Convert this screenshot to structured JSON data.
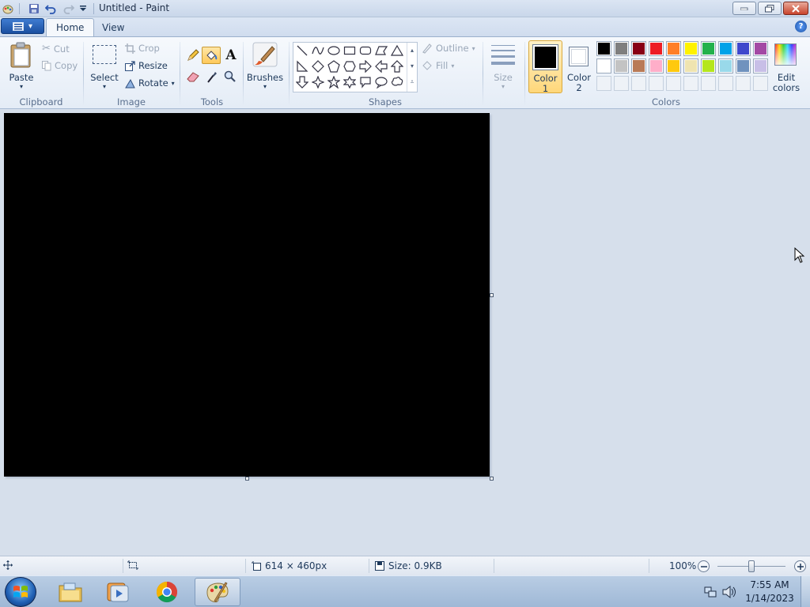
{
  "window": {
    "title": "Untitled - Paint"
  },
  "tabs": [
    {
      "label": "Home",
      "active": true
    },
    {
      "label": "View",
      "active": false
    }
  ],
  "clipboard": {
    "paste": "Paste",
    "cut": "Cut",
    "copy": "Copy",
    "group": "Clipboard"
  },
  "image": {
    "select": "Select",
    "crop": "Crop",
    "resize": "Resize",
    "rotate": "Rotate",
    "group": "Image"
  },
  "tools": {
    "group": "Tools",
    "selected": "fill-bucket"
  },
  "brushes": {
    "label": "Brushes"
  },
  "shapes": {
    "group": "Shapes",
    "outline": "Outline",
    "fill": "Fill"
  },
  "size": {
    "label": "Size"
  },
  "colors": {
    "color1_label_a": "Color",
    "color1_label_b": "1",
    "color2_label_a": "Color",
    "color2_label_b": "2",
    "color1": "#000000",
    "color2": "#ffffff",
    "edit_a": "Edit",
    "edit_b": "colors",
    "group": "Colors",
    "palette_row1": [
      "#000000",
      "#7f7f7f",
      "#880015",
      "#ed1c24",
      "#ff7f27",
      "#fff200",
      "#22b14c",
      "#00a2e8",
      "#3f48cc",
      "#a349a4"
    ],
    "palette_row2": [
      "#ffffff",
      "#c3c3c3",
      "#b97a57",
      "#ffaec9",
      "#ffc90e",
      "#efe4b0",
      "#b5e61d",
      "#99d9ea",
      "#7092be",
      "#c8bfe7"
    ]
  },
  "canvas": {
    "fill": "#000000"
  },
  "status": {
    "dimensions": "614 × 460px",
    "size": "Size: 0.9KB",
    "zoom": "100%"
  },
  "clock": {
    "time": "7:55 AM",
    "date": "1/14/2023"
  }
}
